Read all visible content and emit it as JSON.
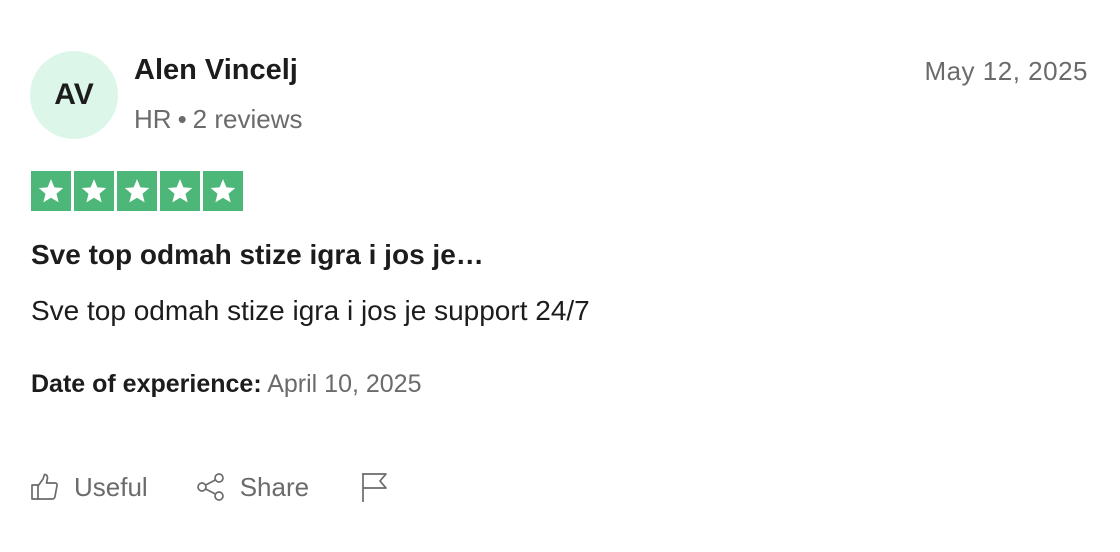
{
  "review": {
    "author": {
      "initials": "AV",
      "name": "Alen Vincelj",
      "country": "HR",
      "separator": "•",
      "review_count": "2 reviews"
    },
    "date": "May 12, 2025",
    "rating": {
      "stars": 5,
      "max": 5,
      "color": "#4db779",
      "icon": "star-icon"
    },
    "title": "Sve top odmah stize igra i jos je…",
    "body": "Sve top odmah stize igra i jos je support 24/7",
    "experience": {
      "label": "Date of experience:",
      "value": "April 10, 2025"
    },
    "actions": {
      "useful": {
        "label": "Useful",
        "icon": "thumbs-up-icon"
      },
      "share": {
        "label": "Share",
        "icon": "share-icon"
      },
      "report": {
        "icon": "flag-icon"
      }
    }
  },
  "colors": {
    "avatar_bg": "#dcf7ea",
    "text": "#1c1c1c",
    "muted": "#6b6b6b"
  }
}
